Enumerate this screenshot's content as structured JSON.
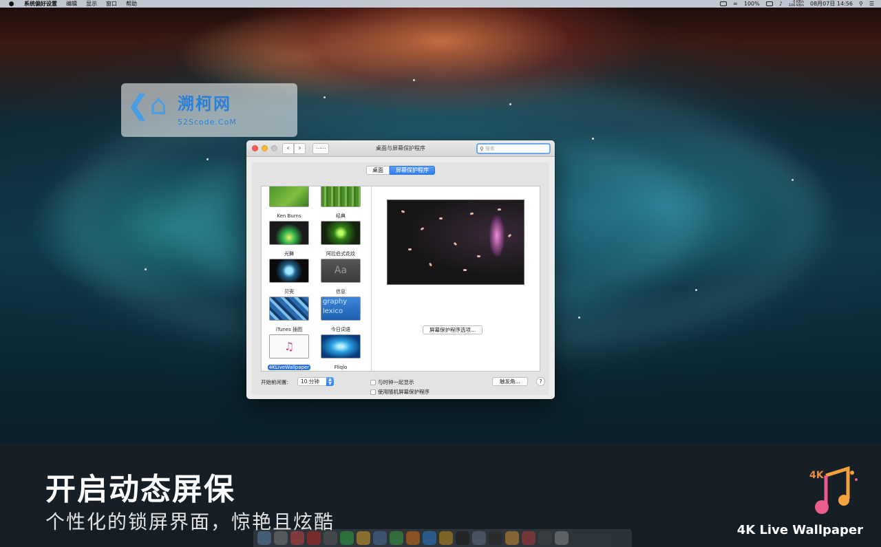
{
  "menubar": {
    "app_name": "系统偏好设置",
    "items": [
      "编辑",
      "显示",
      "窗口",
      "帮助"
    ],
    "battery": "100%",
    "net_up": "0 KB/s",
    "net_down": "106 KB/s",
    "datetime": "08月07日 14:56"
  },
  "window": {
    "title": "桌面与屏幕保护程序",
    "search_placeholder": "搜索",
    "tabs": [
      {
        "label": "桌面",
        "active": false
      },
      {
        "label": "屏幕保护程序",
        "active": true
      }
    ],
    "savers": [
      {
        "label": "Ken Burns",
        "thumb": "kb"
      },
      {
        "label": "经典",
        "thumb": "classic"
      },
      {
        "label": "光舞",
        "thumb": "flurry"
      },
      {
        "label": "阿拉伯式花纹",
        "thumb": "arabesque"
      },
      {
        "label": "贝壳",
        "thumb": "shell"
      },
      {
        "label": "信息",
        "thumb": "message",
        "thumb_text": "Aa"
      },
      {
        "label": "iTunes 插图",
        "thumb": "itunes"
      },
      {
        "label": "今日词语",
        "thumb": "word",
        "thumb_text": "graphy lexico"
      },
      {
        "label": "4KLiveWallpaper",
        "thumb": "lw",
        "selected": true
      },
      {
        "label": "Fliqlo",
        "thumb": "fliqlo"
      }
    ],
    "options_button": "屏幕保护程序选项...",
    "idle_label": "开始前闲置:",
    "idle_value": "10 分钟",
    "show_clock_label": "与时钟一起显示",
    "random_label": "使用随机屏幕保护程序",
    "hot_corners_button": "触发角...",
    "help_button": "?"
  },
  "watermark": {
    "title": "溯柯网",
    "subtitle": "52Scode.CoM"
  },
  "banner": {
    "headline": "开启动态屏保",
    "subline": "个性化的锁屏界面，惊艳且炫酷",
    "brand": "4K Live Wallpaper",
    "logo_text": "4K"
  },
  "colors": {
    "accent": "#2f7ff0",
    "close": "#fc5f57",
    "minimize": "#fdbc2e"
  }
}
